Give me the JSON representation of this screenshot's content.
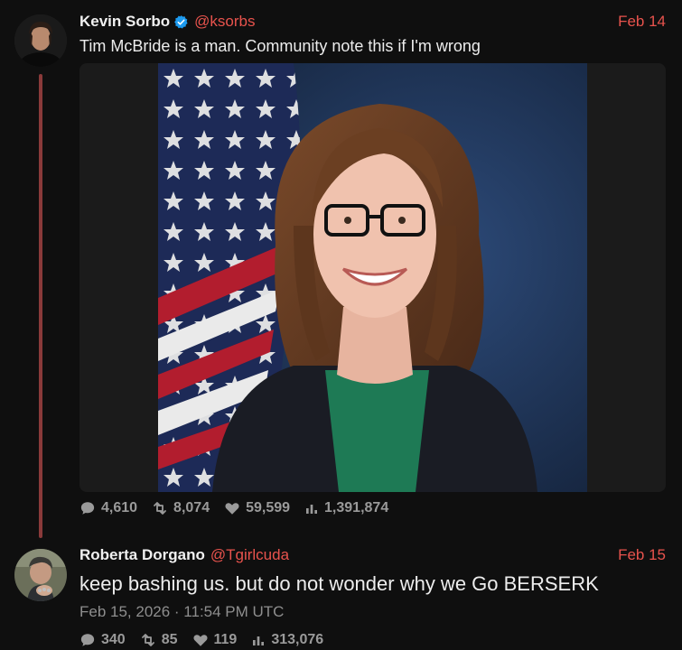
{
  "posts": [
    {
      "display_name": "Kevin Sorbo",
      "handle": "@ksorbs",
      "date": "Feb 14",
      "text": "Tim McBride is a man. Community note this if I'm wrong",
      "stats": {
        "replies": "4,610",
        "reposts": "8,074",
        "likes": "59,599",
        "views": "1,391,874"
      }
    },
    {
      "display_name": "Roberta Dorgano",
      "handle": "@Tgirlcuda",
      "date": "Feb 15",
      "text": "keep bashing us. but do not wonder why we Go BERSERK",
      "timestamp": "Feb 15, 2026 · 11:54 PM UTC",
      "stats": {
        "replies": "340",
        "reposts": "85",
        "likes": "119",
        "views": "313,076"
      }
    }
  ],
  "colors": {
    "accent": "#e8534d",
    "background": "#0f0f0f",
    "thread_line": "#8a3a3a",
    "verified": "#1d9bf0",
    "muted": "#9a9a9a"
  },
  "icons": [
    "verified-badge-icon",
    "reply-icon",
    "repost-icon",
    "like-icon",
    "views-icon"
  ]
}
